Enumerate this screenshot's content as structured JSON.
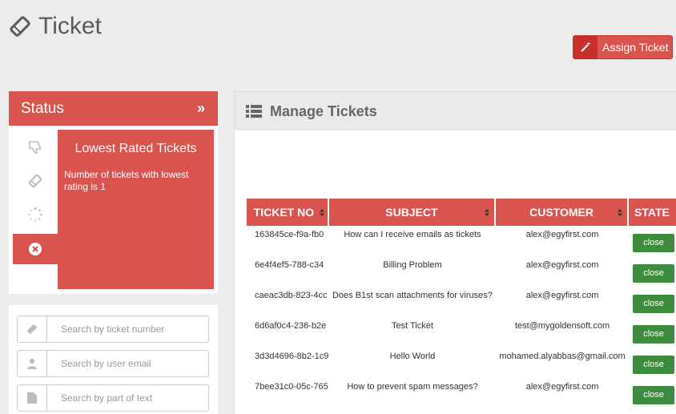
{
  "header": {
    "title": "Ticket",
    "icon": "ticket-icon"
  },
  "assign_button": {
    "label": "Assign Ticket",
    "icon": "magic-wand-icon"
  },
  "status": {
    "title": "Status",
    "tabs": [
      {
        "icon": "thumbs-down-icon",
        "active": false
      },
      {
        "icon": "ticket-icon",
        "active": false
      },
      {
        "icon": "spinner-icon",
        "active": false
      },
      {
        "icon": "close-circle-icon",
        "active": true
      }
    ],
    "content_title": "Lowest Rated Tickets",
    "content_text": "Number of tickets with lowest rating is 1"
  },
  "search": {
    "ticket_placeholder": "Search by ticket number",
    "email_placeholder": "Search by user email",
    "text_placeholder": "Search by part of text"
  },
  "manage": {
    "title": "Manage Tickets"
  },
  "table": {
    "columns": [
      "TICKET NO",
      "SUBJECT",
      "CUSTOMER",
      "STATE"
    ],
    "rows": [
      {
        "ticket_no": "163845ce-f9a-fb0",
        "subject": "How can I receive emails as tickets",
        "customer": "alex@egyfirst.com",
        "state": "close"
      },
      {
        "ticket_no": "6e4f4ef5-788-c34",
        "subject": "Billing Problem",
        "customer": "alex@egyfirst.com",
        "state": "close"
      },
      {
        "ticket_no": "caeac3db-823-4cc",
        "subject": "Does B1st scan attachments for viruses?",
        "customer": "alex@egyfirst.com",
        "state": "close"
      },
      {
        "ticket_no": "6d6af0c4-236-b2e",
        "subject": "Test Ticket",
        "customer": "test@mygoldensoft.com",
        "state": "close"
      },
      {
        "ticket_no": "3d3d4696-8b2-1c9",
        "subject": "Hello World",
        "customer": "mohamed.alyabbas@gmail.com",
        "state": "close"
      },
      {
        "ticket_no": "7bee31c0-05c-765",
        "subject": "How to prevent spam messages?",
        "customer": "alex@egyfirst.com",
        "state": "close"
      }
    ]
  },
  "colors": {
    "accent": "#d9534f",
    "success": "#3d8b3d",
    "background": "#ececec"
  }
}
